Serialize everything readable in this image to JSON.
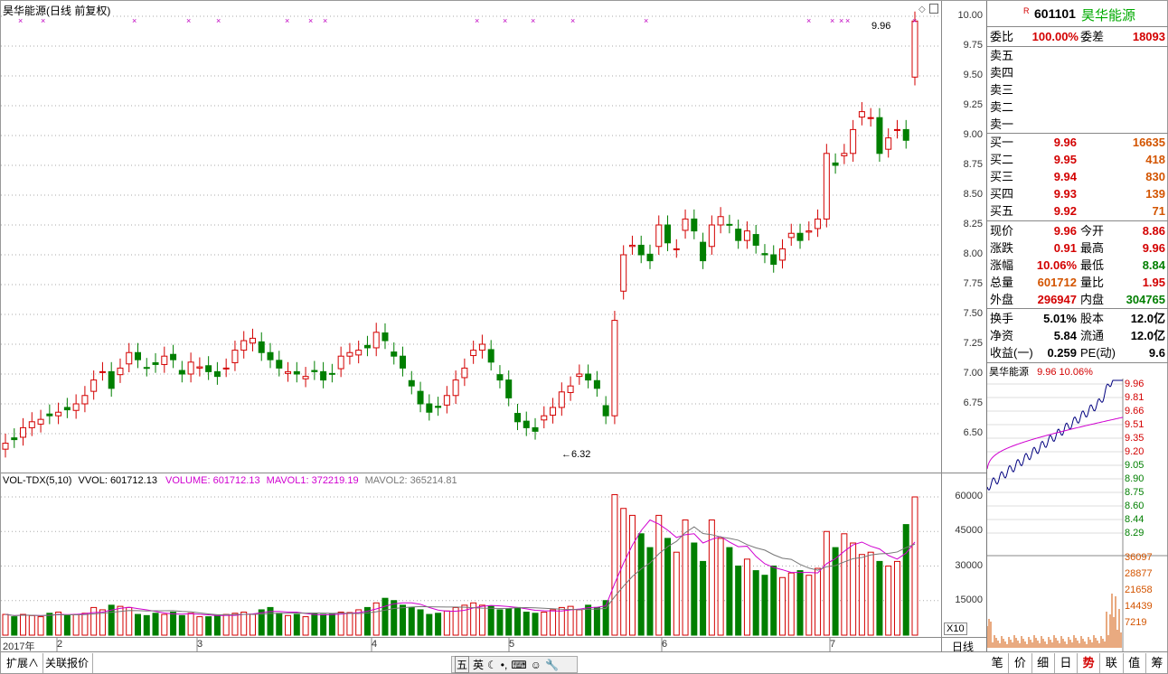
{
  "main": {
    "title": "昊华能源(日线 前复权)",
    "price_ticks": [
      "10.00",
      "9.75",
      "9.50",
      "9.25",
      "9.00",
      "8.75",
      "8.50",
      "8.25",
      "8.00",
      "7.75",
      "7.50",
      "7.25",
      "7.00",
      "6.75",
      "6.50"
    ],
    "high_label": "9.96",
    "low_label": "6.32",
    "date_labels": [
      "2017年",
      "2",
      "3",
      "4",
      "5",
      "6",
      "7"
    ],
    "period_label": "日线"
  },
  "volume": {
    "indicator": "VOL-TDX(5,10)",
    "vvol": "VVOL: 601712.13",
    "volume": "VOLUME: 601712.13",
    "mavol1": "MAVOL1: 372219.19",
    "mavol2": "MAVOL2: 365214.81",
    "ticks": [
      "60000",
      "45000",
      "30000",
      "15000"
    ],
    "unit": "X10"
  },
  "quote": {
    "code": "601101",
    "name": "昊华能源",
    "weibi_label": "委比",
    "weibi": "100.00%",
    "weicha_label": "委差",
    "weicha": "18093",
    "sell": [
      {
        "label": "卖五"
      },
      {
        "label": "卖四"
      },
      {
        "label": "卖三"
      },
      {
        "label": "卖二"
      },
      {
        "label": "卖一"
      }
    ],
    "buy": [
      {
        "label": "买一",
        "price": "9.96",
        "vol": "16635"
      },
      {
        "label": "买二",
        "price": "9.95",
        "vol": "418"
      },
      {
        "label": "买三",
        "price": "9.94",
        "vol": "830"
      },
      {
        "label": "买四",
        "price": "9.93",
        "vol": "139"
      },
      {
        "label": "买五",
        "price": "9.92",
        "vol": "71"
      }
    ],
    "stats": [
      {
        "l1": "现价",
        "v1": "9.96",
        "l2": "今开",
        "v2": "8.86"
      },
      {
        "l1": "涨跌",
        "v1": "0.91",
        "l2": "最高",
        "v2": "9.96"
      },
      {
        "l1": "涨幅",
        "v1": "10.06%",
        "l2": "最低",
        "v2": "8.84"
      },
      {
        "l1": "总量",
        "v1": "601712",
        "l2": "量比",
        "v2": "1.95"
      },
      {
        "l1": "外盘",
        "v1": "296947",
        "l2": "内盘",
        "v2": "304765"
      }
    ],
    "fin": [
      {
        "l1": "换手",
        "v1": "5.01%",
        "l2": "股本",
        "v2": "12.0亿"
      },
      {
        "l1": "净资",
        "v1": "5.84",
        "l2": "流通",
        "v2": "12.0亿"
      },
      {
        "l1": "收益(一)",
        "v1": "0.259",
        "l2": "PE(动)",
        "v2": "9.6"
      }
    ]
  },
  "mini": {
    "name": "昊华能源",
    "price": "9.96",
    "pct": "10.06%",
    "ticks": [
      "9.96",
      "9.81",
      "9.66",
      "9.51",
      "9.35",
      "9.20",
      "9.05",
      "8.90",
      "8.75",
      "8.60",
      "8.44",
      "8.29"
    ],
    "vol_ticks": [
      "36097",
      "28877",
      "21658",
      "14439",
      "7219"
    ]
  },
  "bottom_tabs": [
    "扩展∧",
    "关联报价"
  ],
  "right_tabs": [
    "笔",
    "价",
    "细",
    "日",
    "势",
    "联",
    "值",
    "筹"
  ],
  "toolbar": [
    "五",
    "英"
  ]
}
